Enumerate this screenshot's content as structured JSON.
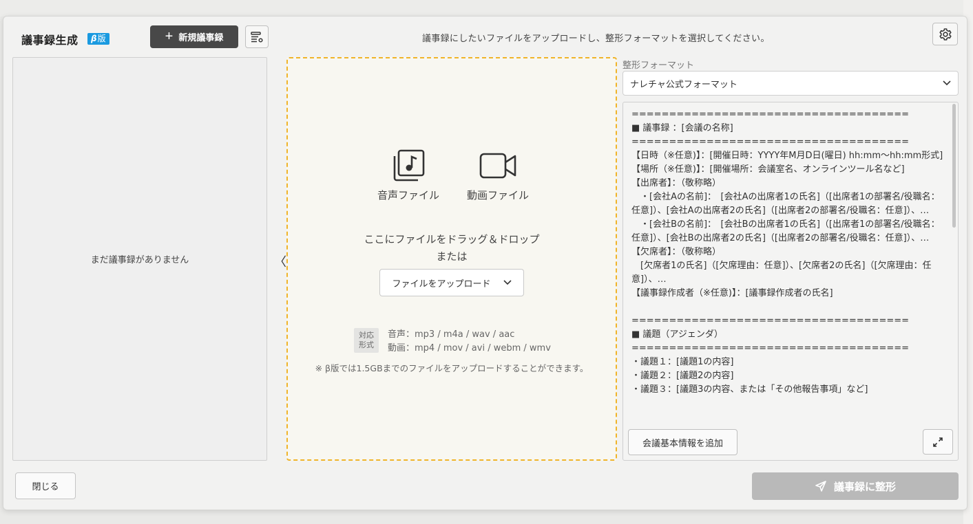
{
  "header": {
    "title": "議事録生成",
    "beta_prefix": "β",
    "beta_suffix": "版",
    "new_button": "新規議事録",
    "instruction": "議事録にしたいファイルをアップロードし、整形フォーマットを選択してください。"
  },
  "sidebar": {
    "empty_message": "まだ議事録がありません",
    "collapse_icon": "chevron-left"
  },
  "upload": {
    "audio_label": "音声ファイル",
    "video_label": "動画ファイル",
    "drop_line1": "ここにファイルをドラッグ＆ドロップ",
    "drop_line2": "または",
    "upload_button": "ファイルをアップロード",
    "formats_badge_line1": "対応",
    "formats_badge_line2": "形式",
    "audio_formats": "音声：mp3 / m4a / wav / aac",
    "video_formats": "動画：mp4 / mov / avi / webm / wmv",
    "note": "※ β版では1.5GBまでのファイルをアップロードすることができます。"
  },
  "format": {
    "label": "整形フォーマット",
    "selected": "ナレチャ公式フォーマット",
    "template": "=====================================\n■ 議事録 ：[会議の名称]\n=====================================\n【日時（※任意)】：[開催日時：YYYY年M月D日(曜日) hh:mm〜hh:mm形式]\n【場所（※任意)】：[開催場所：会議室名、オンラインツール名など]\n【出席者】：（敬称略）\n　・[会社Aの名前]：　[会社Aの出席者1の氏名]（[出席者1の部署名/役職名：任意]）、[会社Aの出席者2の氏名]（[出席者2の部署名/役職名：任意]）、…\n　・[会社Bの名前]：　[会社Bの出席者1の氏名]（[出席者1の部署名/役職名：任意]）、[会社Bの出席者2の氏名]（[出席者2の部署名/役職名：任意]）、…\n【欠席者】：（敬称略）\n　[欠席者1の氏名]（[欠席理由：任意]）、[欠席者2の氏名]（[欠席理由：任意]）、…\n【議事録作成者（※任意)】：[議事録作成者の氏名]\n\n=====================================\n■ 議題（アジェンダ）\n=====================================\n・議題１：[議題1の内容]\n・議題２：[議題2の内容]\n・議題３：[議題3の内容、または「その他報告事項」など]",
    "add_info_button": "会議基本情報を追加"
  },
  "footer": {
    "close_button": "閉じる",
    "format_button": "議事録に整形"
  }
}
